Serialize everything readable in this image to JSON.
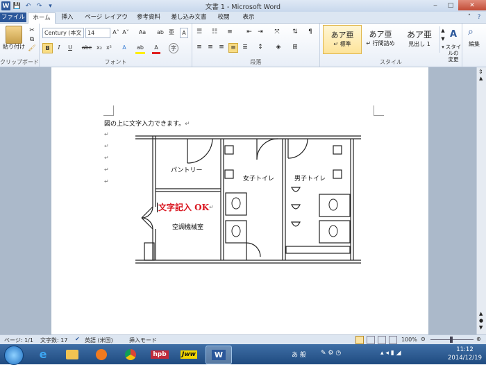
{
  "window": {
    "title": "文書 1 - Microsoft Word",
    "controls": [
      "‒",
      "□",
      "✕"
    ]
  },
  "qat": {
    "logo": "W",
    "save": "💾",
    "undo": "↶",
    "redo": "↷",
    "more": "▾"
  },
  "tabs": [
    "ファイル",
    "ホーム",
    "挿入",
    "ページ レイアウト",
    "参考資料",
    "差し込み文書",
    "校閲",
    "表示"
  ],
  "ribbon": {
    "clipboard": {
      "paste": "貼り付け",
      "label": "クリップボード"
    },
    "font": {
      "name": "Century (本文",
      "size": "14",
      "label": "フォント",
      "grow": "A˄",
      "shrink": "A˅",
      "case": "Aa",
      "clear": "ab",
      "ruby": "亜",
      "border": "A",
      "bold": "B",
      "italic": "I",
      "underline": "U",
      "strike": "abc",
      "sub": "x₂",
      "sup": "x²",
      "effect": "A",
      "highlight": "ab",
      "color": "A",
      "enclose": "字"
    },
    "paragraph": {
      "label": "段落"
    },
    "styles": {
      "label": "スタイル",
      "items": [
        {
          "sample": "あア亜",
          "name": "↵ 標準"
        },
        {
          "sample": "あア亜",
          "name": "↵ 行間詰め"
        },
        {
          "sample": "あア亜",
          "name": "見出し 1"
        }
      ],
      "change": "スタイルの\n変更"
    },
    "editing": {
      "label": "編集"
    }
  },
  "document": {
    "first_line": "図の上に文字入力できます。",
    "pilcrow": "↵",
    "empty_marks": [
      "↵",
      "↵",
      "↵",
      "↵",
      "↵"
    ],
    "floorplan": {
      "pantry": "パントリー",
      "womens_toilet": "女子トイレ",
      "mens_toilet": "男子トイレ",
      "machine_room": "空調機械室",
      "annotation": "文字記入 OK",
      "annotation_color": "#d9141e"
    }
  },
  "status": {
    "page": "ページ: 1/1",
    "words": "文字数: 17",
    "language": "英語 (米国)",
    "mode": "挿入モード",
    "zoom": "100%"
  },
  "taskbar": {
    "apps": [
      "hpb",
      "Jww",
      "W"
    ],
    "ime": "あ 般",
    "time": "11:12",
    "date": "2014/12/19"
  }
}
